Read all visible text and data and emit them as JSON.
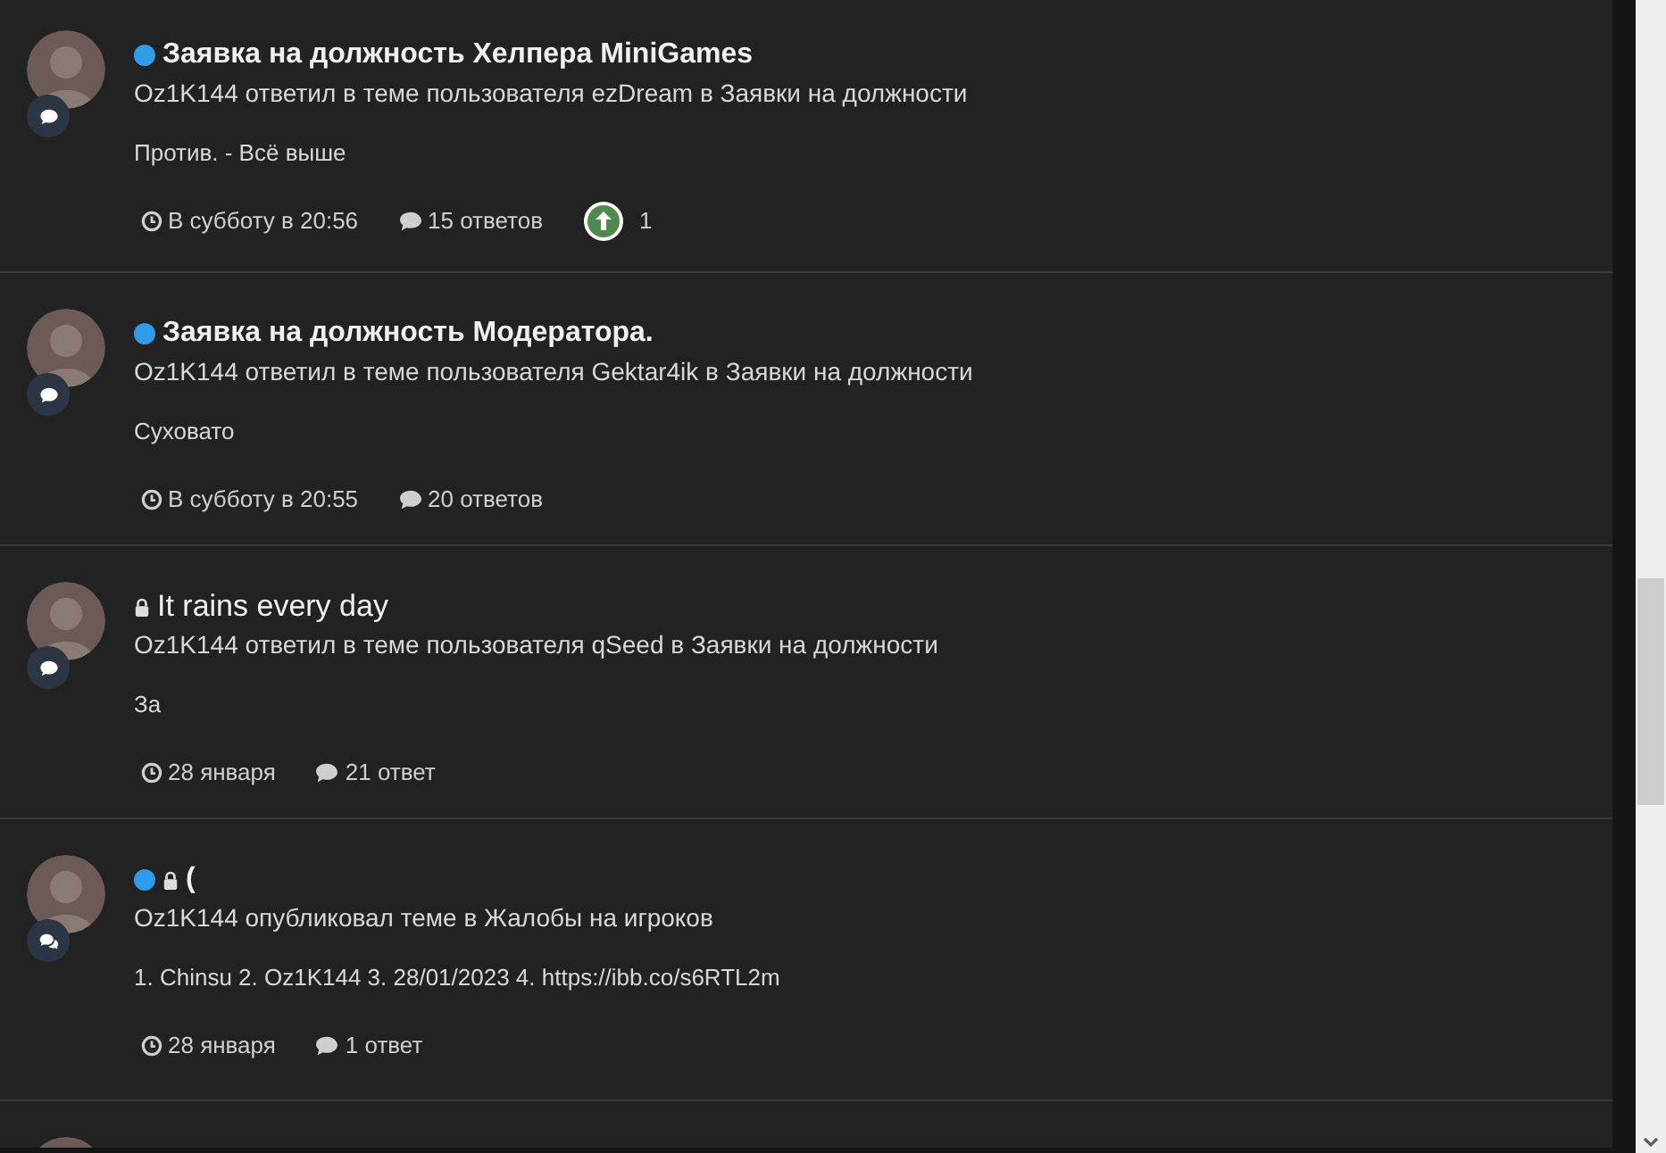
{
  "items": [
    {
      "unread": true,
      "locked": false,
      "bold": true,
      "title": "Заявка на должность Хелпера MiniGames",
      "meta": "Oz1K144 ответил в теме пользователя ezDream в Заявки на должности",
      "snippet": "Против. - Всё выше",
      "date": "В субботу в 20:56",
      "replies": "15 ответов",
      "reputation": "1",
      "kind": "reply"
    },
    {
      "unread": true,
      "locked": false,
      "bold": true,
      "title": "Заявка на должность Модератора.",
      "meta": "Oz1K144 ответил в теме пользователя Gektar4ik в Заявки на должности",
      "snippet": "Суховато",
      "date": "В субботу в 20:55",
      "replies": "20 ответов",
      "kind": "reply"
    },
    {
      "unread": false,
      "locked": true,
      "bold": false,
      "title": "It rains every day",
      "meta": "Oz1K144 ответил в теме пользователя qSeed в Заявки на должности",
      "snippet": "За",
      "date": "28 января",
      "replies": "21 ответ",
      "kind": "reply"
    },
    {
      "unread": true,
      "locked": true,
      "bold": true,
      "title": "(",
      "meta": "Oz1K144 опубликовал теме в Жалобы на игроков",
      "snippet": "1. Chinsu 2. Oz1K144 3. 28/01/2023 4. https://ibb.co/s6RTL2m",
      "date": "28 января",
      "replies": "1 ответ",
      "kind": "topic"
    }
  ]
}
